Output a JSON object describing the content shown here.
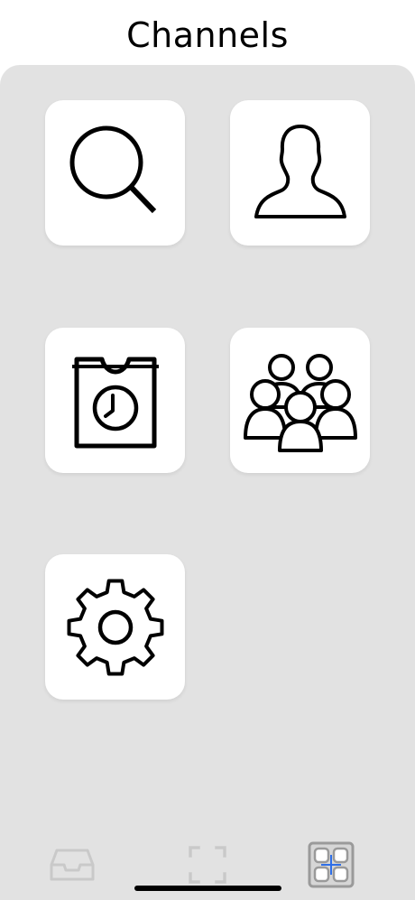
{
  "header": {
    "title": "Channels"
  },
  "tiles": [
    {
      "name": "search",
      "icon": "search-icon"
    },
    {
      "name": "contacts",
      "icon": "person-icon"
    },
    {
      "name": "archive",
      "icon": "archive-clock-icon"
    },
    {
      "name": "groups",
      "icon": "group-icon"
    },
    {
      "name": "settings",
      "icon": "gear-icon"
    }
  ],
  "tab_bar": {
    "tabs": [
      {
        "name": "inbox",
        "icon": "inbox-tray-icon",
        "active": false
      },
      {
        "name": "scan",
        "icon": "scan-frame-icon",
        "active": false
      },
      {
        "name": "channels",
        "icon": "channels-grid-icon",
        "active": true
      }
    ],
    "active_color": "#2f6fe8",
    "inactive_color": "#c9c9c9"
  },
  "colors": {
    "panel_background": "#e2e2e2",
    "tile_background": "#ffffff",
    "icon_stroke": "#000000"
  }
}
